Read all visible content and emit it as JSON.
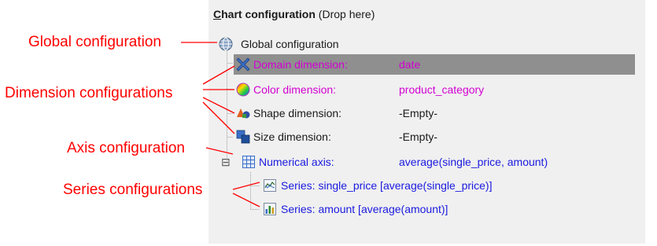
{
  "panel": {
    "header_underlined": "C",
    "header_title_rest": "hart configuration",
    "header_hint": " (Drop here)"
  },
  "tree": {
    "global": {
      "label": "Global configuration",
      "icon": "globe-icon"
    },
    "dimensions": [
      {
        "label": "Domain dimension:",
        "value": "date",
        "icon": "cross-arrows-icon",
        "selected": true
      },
      {
        "label": "Color dimension:",
        "value": "product_category",
        "icon": "color-wheel-icon"
      },
      {
        "label": "Shape dimension:",
        "value": "-Empty-",
        "icon": "shapes-icon"
      },
      {
        "label": "Size dimension:",
        "value": "-Empty-",
        "icon": "size-squares-icon"
      }
    ],
    "axis": {
      "label": "Numerical axis:",
      "value": "average(single_price, amount)",
      "icon": "grid-axis-icon",
      "expand_symbol": "⊟"
    },
    "series": [
      {
        "label": "Series: single_price [average(single_price)]",
        "icon": "line-chart-icon"
      },
      {
        "label": "Series: amount [average(amount)]",
        "icon": "bar-chart-icon"
      }
    ]
  },
  "annotations": {
    "global": "Global configuration",
    "dimensions": "Dimension configurations",
    "axis": "Axis configuration",
    "series": "Series configurations"
  },
  "colors": {
    "annotation": "#ff0000",
    "dimension_text_magenta": "#d200d2",
    "axis_text_blue": "#1a1ae0",
    "selection": "#8f8f8f",
    "panel_bg": "#f0f0f0"
  }
}
